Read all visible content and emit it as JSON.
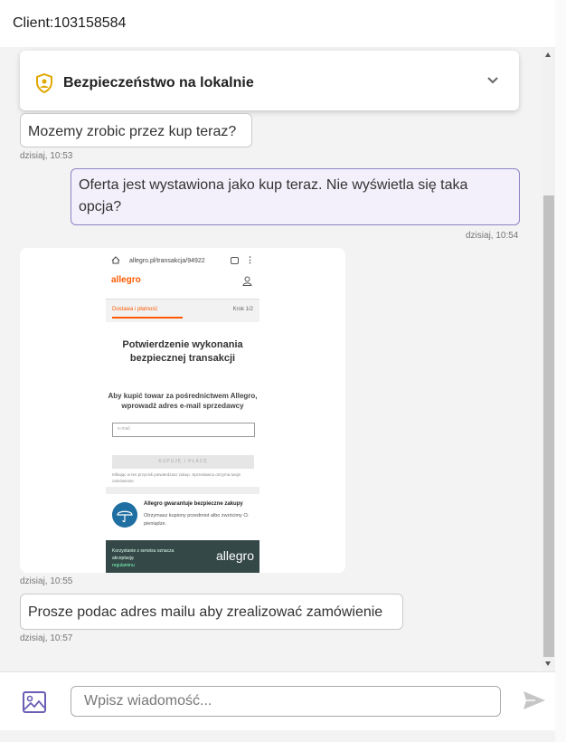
{
  "header": {
    "title": "Client:103158584"
  },
  "banner": {
    "title": "Bezpieczeństwo na lokalnie"
  },
  "messages": [
    {
      "text": "Mozemy zrobic przez kup teraz?",
      "time": "dzisiaj, 10:53"
    },
    {
      "text": "Oferta jest wystawiona jako kup teraz. Nie wyświetla się taka opcja?",
      "time": "dzisiaj, 10:54"
    },
    {
      "time": "dzisiaj, 10:55"
    },
    {
      "text": "Prosze podac adres mailu aby zrealizować zamówienie",
      "time": "dzisiaj, 10:57"
    }
  ],
  "screenshot": {
    "url": "allegro.pl/transakcja/94922",
    "logo": "allegro",
    "step_label": "Dostawa i płatność",
    "step_count": "Krok 1/2",
    "heading": "Potwierdzenie wykonania bezpiecznej transakcji",
    "instruction": "Aby kupić towar za pośrednictwem Allegro, wprowadź adres e-mail sprzedawcy",
    "email_placeholder": "e-mail",
    "button": "KUPUJĘ I PŁACĘ",
    "small_print": "Klikając w ten przycisk potwierdzasz zakup. Sprzedawca otrzyma twoje zamówienie.",
    "guarantee_title": "Allegro gwarantuje bezpieczne zakupy",
    "guarantee_text": "Otrzymasz kupiony przedmiot albo zwrócimy Ci pieniądze.",
    "footer_text": "Korzystanie z serwisu oznacza akceptację",
    "footer_link": "regulaminu",
    "footer_logo": "allegro"
  },
  "composer": {
    "placeholder": "Wpisz wiadomość..."
  },
  "colors": {
    "accent": "#6a5fb5",
    "outgoing_bubble": "#f3f0fb",
    "outgoing_border": "#8d84c6",
    "shield": "#e0a800"
  }
}
